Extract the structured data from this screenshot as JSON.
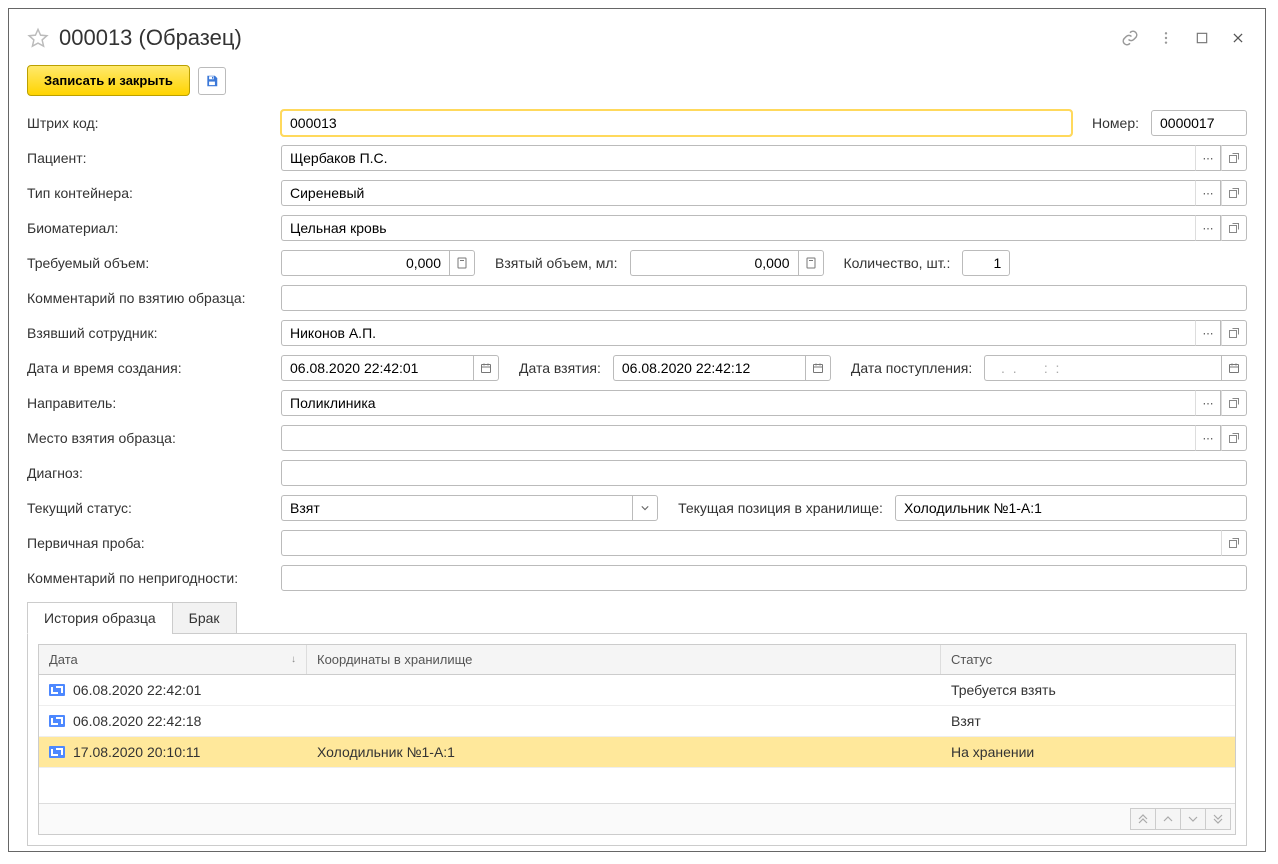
{
  "title": "000013 (Образец)",
  "toolbar": {
    "save_close": "Записать и закрыть"
  },
  "labels": {
    "barcode": "Штрих код:",
    "number": "Номер:",
    "patient": "Пациент:",
    "container_type": "Тип контейнера:",
    "biomaterial": "Биоматериал:",
    "required_volume": "Требуемый объем:",
    "taken_volume": "Взятый объем, мл:",
    "quantity": "Количество, шт.:",
    "sample_comment": "Комментарий по взятию образца:",
    "taken_by": "Взявший сотрудник:",
    "created_at": "Дата и время создания:",
    "taken_at": "Дата взятия:",
    "received_at": "Дата поступления:",
    "referrer": "Направитель:",
    "sample_location": "Место взятия образца:",
    "diagnosis": "Диагноз:",
    "current_status": "Текущий статус:",
    "current_storage_pos": "Текущая позиция в хранилище:",
    "primary_sample": "Первичная проба:",
    "unsuitable_comment": "Комментарий по непригодности:"
  },
  "values": {
    "barcode": "000013",
    "number": "0000017",
    "patient": "Щербаков П.С.",
    "container_type": "Сиреневый",
    "biomaterial": "Цельная кровь",
    "required_volume": "0,000",
    "taken_volume": "0,000",
    "quantity": "1",
    "sample_comment": "",
    "taken_by": "Никонов А.П.",
    "created_at": "06.08.2020 22:42:01",
    "taken_at": "06.08.2020 22:42:12",
    "received_at": "  .  .       :  :",
    "referrer": "Поликлиника",
    "sample_location": "",
    "diagnosis": "",
    "current_status": "Взят",
    "current_storage_pos": "Холодильник №1-A:1",
    "primary_sample": "",
    "unsuitable_comment": ""
  },
  "tabs": {
    "history": "История образца",
    "reject": "Брак"
  },
  "grid": {
    "columns": {
      "date": "Дата",
      "coords": "Координаты в хранилище",
      "status": "Статус"
    },
    "rows": [
      {
        "date": "06.08.2020 22:42:01",
        "coords": "",
        "status": "Требуется взять",
        "selected": false
      },
      {
        "date": "06.08.2020 22:42:18",
        "coords": "",
        "status": "Взят",
        "selected": false
      },
      {
        "date": "17.08.2020 20:10:11",
        "coords": "Холодильник №1-A:1",
        "status": "На хранении",
        "selected": true
      }
    ]
  }
}
